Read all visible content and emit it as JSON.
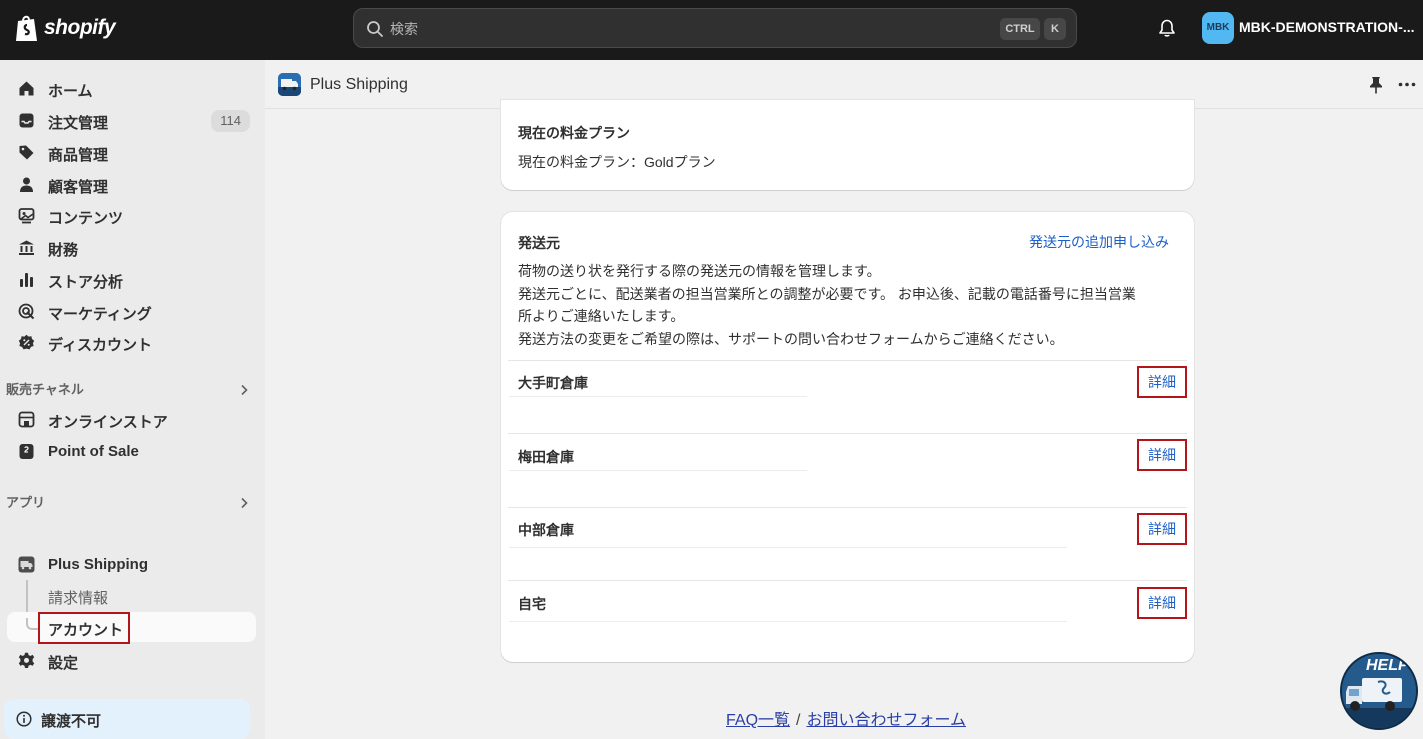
{
  "topbar": {
    "logo_text": "shopify",
    "search_placeholder": "検索",
    "shortcut_ctrl": "CTRL",
    "shortcut_k": "K",
    "store_initials": "MBK",
    "store_name": "MBK-DEMONSTRATION-..."
  },
  "sidebar": {
    "items": [
      {
        "label": "ホーム",
        "icon": "home-icon"
      },
      {
        "label": "注文管理",
        "icon": "inbox-icon",
        "badge": "114"
      },
      {
        "label": "商品管理",
        "icon": "tag-icon"
      },
      {
        "label": "顧客管理",
        "icon": "person-icon"
      },
      {
        "label": "コンテンツ",
        "icon": "content-icon"
      },
      {
        "label": "財務",
        "icon": "bank-icon"
      },
      {
        "label": "ストア分析",
        "icon": "bar-chart-icon"
      },
      {
        "label": "マーケティング",
        "icon": "target-icon"
      },
      {
        "label": "ディスカウント",
        "icon": "discount-icon"
      }
    ],
    "sales_channels_title": "販売チャネル",
    "sales_channels": [
      {
        "label": "オンラインストア",
        "icon": "store-icon"
      },
      {
        "label": "Point of Sale",
        "icon": "pos-icon"
      }
    ],
    "apps_title": "アプリ",
    "app_name": "Plus Shipping",
    "app_sub_items": [
      "請求情報",
      "アカウント"
    ],
    "settings_label": "設定",
    "non_transferable_label": "譲渡不可"
  },
  "app_header": {
    "title": "Plus Shipping"
  },
  "plan_card": {
    "title": "現在の料金プラン",
    "text": "現在の料金プラン：Goldプラン"
  },
  "origin_card": {
    "title": "発送元",
    "add_link": "発送元の追加申し込み",
    "desc_1": "荷物の送り状を発行する際の発送元の情報を管理します。",
    "desc_2": "発送元ごとに、配送業者の担当営業所との調整が必要です。 お申込後、記載の電話番号に担当営業",
    "desc_3": "所よりご連絡いたします。",
    "desc_4": "発送方法の変更をご希望の際は、サポートの問い合わせフォームからご連絡ください。",
    "detail_label": "詳細",
    "origins": [
      "大手町倉庫",
      "梅田倉庫",
      "中部倉庫",
      "自宅"
    ]
  },
  "footer": {
    "faq_link": "FAQ一覧",
    "separator": "/",
    "contact_link": "お問い合わせフォーム"
  },
  "help_badge": {
    "label": "HELP"
  },
  "colors": {
    "accent_link": "#1c5fc9",
    "highlight_border": "#b3151b",
    "topbar_bg": "#1a1a1a"
  }
}
